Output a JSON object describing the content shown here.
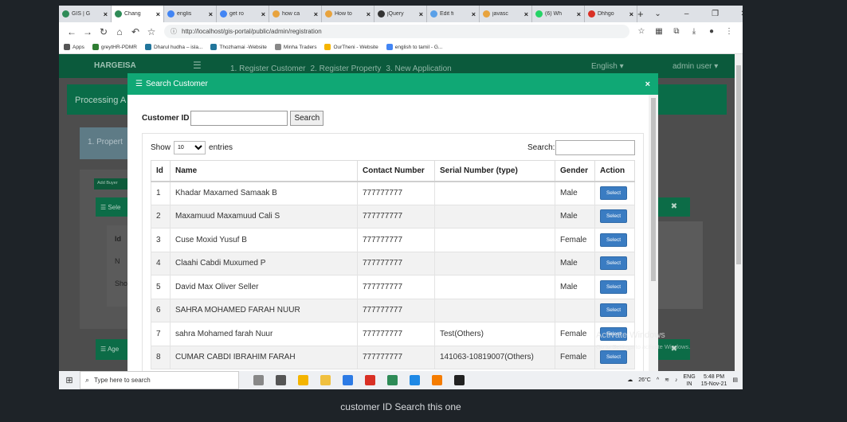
{
  "browser": {
    "tabs": [
      {
        "title": "GIS | G",
        "color": "#2e8b57",
        "active": false
      },
      {
        "title": "Chang",
        "color": "#2e8b57",
        "active": true
      },
      {
        "title": "englis",
        "color": "#4285f4",
        "active": false
      },
      {
        "title": "get ro",
        "color": "#4285f4",
        "active": false
      },
      {
        "title": "how ca",
        "color": "#e8a33d",
        "active": false
      },
      {
        "title": "How to",
        "color": "#e8a33d",
        "active": false
      },
      {
        "title": "jQuery",
        "color": "#333333",
        "active": false
      },
      {
        "title": "Edit fi",
        "color": "#5aa0e8",
        "active": false
      },
      {
        "title": "javasc",
        "color": "#e8a33d",
        "active": false
      },
      {
        "title": "(6) Wh",
        "color": "#25d366",
        "active": false
      },
      {
        "title": "Dhhgo",
        "color": "#d93025",
        "active": false
      }
    ],
    "new_tab": "+",
    "url": "http://localhost/gis-portal/public/admin/registration",
    "bookmarks": [
      {
        "label": "Apps",
        "color": "#555555"
      },
      {
        "label": "greytHR-PDMR",
        "color": "#2e7d32"
      },
      {
        "label": "Dharul hudha – isla...",
        "color": "#21759b"
      },
      {
        "label": "Thozhamai -Website",
        "color": "#21759b"
      },
      {
        "label": "Minha Traders",
        "color": "#888888"
      },
      {
        "label": "OurTheni - Website",
        "color": "#f5b400"
      },
      {
        "label": "english to tamil - G...",
        "color": "#4285f4"
      }
    ]
  },
  "app": {
    "logo": "HARGEISA",
    "menu": [
      "1. Register Customer",
      "2. Register Property",
      "3. New Application"
    ],
    "language": "English ▾",
    "user": "admin user ▾",
    "processing": "Processing A",
    "step": "1. Propert",
    "add_buyer": "Add Buyer",
    "select_head": "Sele",
    "inner_id": "Id",
    "inner_n": "N",
    "inner_show": "Sho",
    "agent_head": "Age",
    "close_x": "✖"
  },
  "modal": {
    "title": "Search Customer",
    "close": "×",
    "customer_id_label": "Customer ID",
    "customer_id_value": "",
    "search_button": "Search",
    "show_label": "Show",
    "entries_value": "10",
    "entries_label": "entries",
    "search_label": "Search:",
    "columns": [
      "Id",
      "Name",
      "Contact Number",
      "Serial Number (type)",
      "Gender",
      "Action"
    ],
    "select_label": "Select",
    "rows": [
      {
        "id": "1",
        "name": "Khadar Maxamed Samaak B",
        "contact": "777777777",
        "serial": "",
        "gender": "Male"
      },
      {
        "id": "2",
        "name": "Maxamuud Maxamuud Cali S",
        "contact": "777777777",
        "serial": "",
        "gender": "Male"
      },
      {
        "id": "3",
        "name": "Cuse Moxid Yusuf B",
        "contact": "777777777",
        "serial": "",
        "gender": "Female"
      },
      {
        "id": "4",
        "name": "Claahi Cabdi Muxumed P",
        "contact": "777777777",
        "serial": "",
        "gender": "Male"
      },
      {
        "id": "5",
        "name": "David Max Oliver Seller",
        "contact": "777777777",
        "serial": "",
        "gender": "Male"
      },
      {
        "id": "6",
        "name": "SAHRA MOHAMED FARAH NUUR",
        "contact": "777777777",
        "serial": "",
        "gender": ""
      },
      {
        "id": "7",
        "name": "sahra Mohamed farah Nuur",
        "contact": "777777777",
        "serial": "Test(Others)",
        "gender": "Female"
      },
      {
        "id": "8",
        "name": "CUMAR CABDI IBRAHIM FARAH",
        "contact": "777777777",
        "serial": "141063-10819007(Others)",
        "gender": "Female"
      }
    ]
  },
  "watermark": {
    "line1": "Activate Windows",
    "line2": "Go to Settings to activate Windows."
  },
  "taskbar": {
    "search_placeholder": "Type here to search",
    "apps": [
      "#888888",
      "#555555",
      "#f4b400",
      "#f0c040",
      "#2d7be5",
      "#d93025",
      "#2e8b57",
      "#1e88e5",
      "#f57c00",
      "#222222"
    ],
    "temperature": "26°C",
    "lang": "ENG",
    "region": "IN",
    "time": "5:48 PM",
    "date": "15-Nov-21"
  },
  "caption": "customer ID Search this one"
}
